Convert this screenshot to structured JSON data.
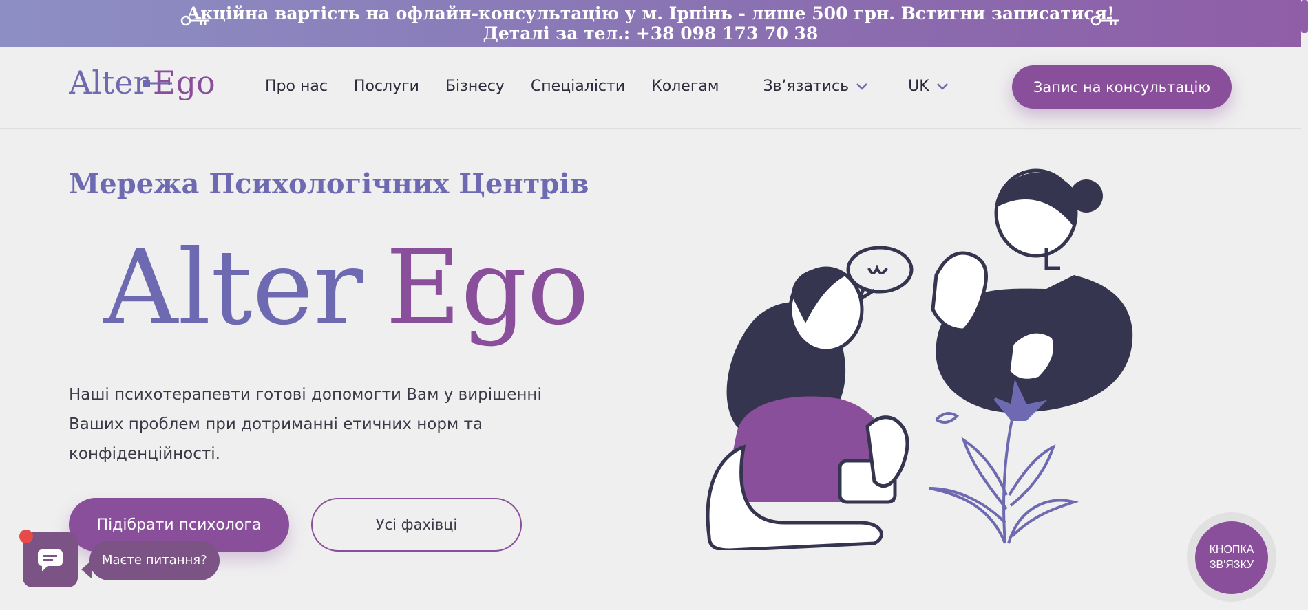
{
  "promo": {
    "line1": "Акційна вартість на офлайн-консультацію у м. Ірпінь - лише 500 грн. Встигни записатися!",
    "line2": "Деталі за тел.: +38 098 173 70 38"
  },
  "header": {
    "logo_text": "Alter Ego",
    "nav": [
      "Про нас",
      "Послуги",
      "Бізнесу",
      "Спеціалісти",
      "Колегам"
    ],
    "contact_label": "Зв’язатись",
    "lang_label": "UK",
    "cta_label": "Запис на консультацію"
  },
  "hero": {
    "subtitle": "Мережа Психологічних Центрів",
    "brand_word1": "Alter",
    "brand_word2": "Ego",
    "description": "Наші психотерапевти готові допомогти Вам у вирішенні Ваших проблем при дотриманні етичних норм та конфіденційності.",
    "primary_button": "Підібрати психолога",
    "secondary_button": "Усі фахівці"
  },
  "chat": {
    "bubble_text": "Маєте питання?"
  },
  "callback": {
    "line1": "КНОПКА",
    "line2": "ЗВ'ЯЗКУ"
  },
  "colors": {
    "accent": "#8a4f9b",
    "brand_blue": "#6e6ab2",
    "dark_ink": "#363550"
  }
}
